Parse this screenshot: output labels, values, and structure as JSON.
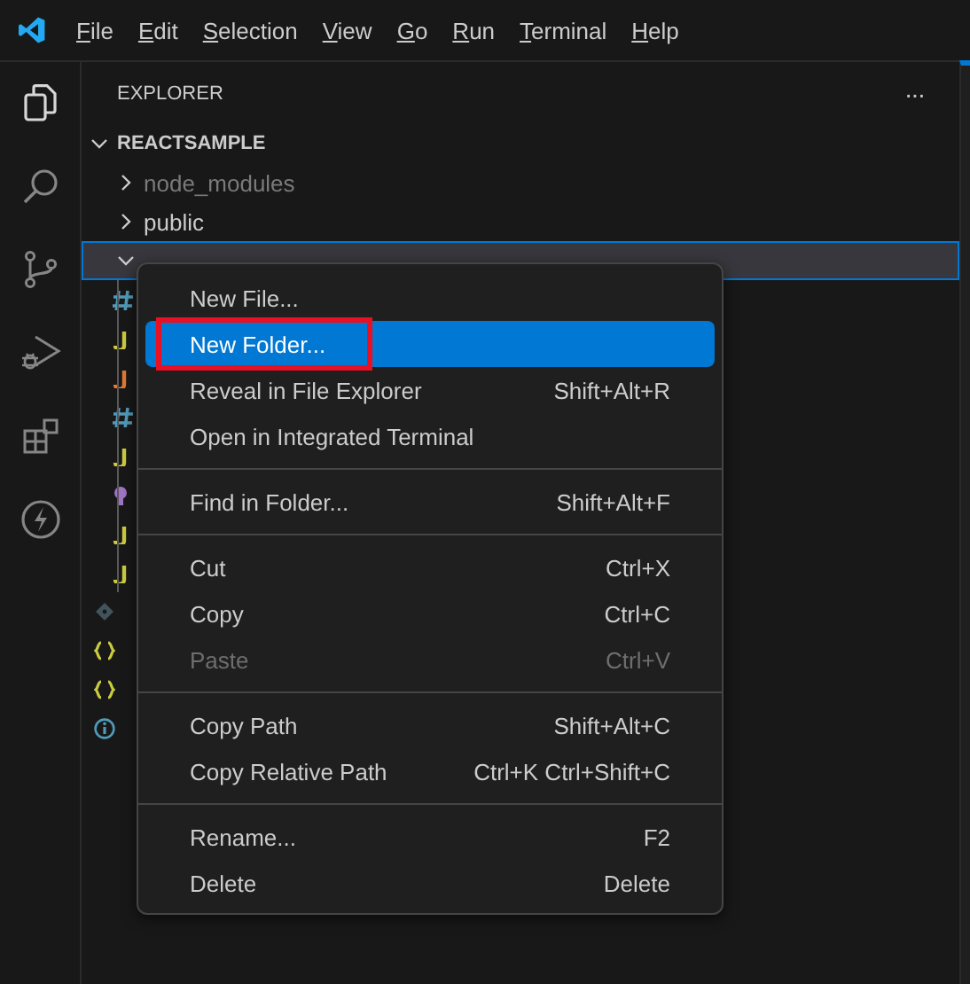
{
  "menu_bar": [
    "File",
    "Edit",
    "Selection",
    "View",
    "Go",
    "Run",
    "Terminal",
    "Help"
  ],
  "activity_bar": [
    {
      "kind": "explorer",
      "selected": true
    },
    {
      "kind": "search",
      "selected": false
    },
    {
      "kind": "source-control",
      "selected": false
    },
    {
      "kind": "run-debug",
      "selected": false
    },
    {
      "kind": "extensions",
      "selected": false
    },
    {
      "kind": "lightning",
      "selected": false
    }
  ],
  "explorer": {
    "title": "EXPLORER",
    "more": "···",
    "tree": [
      {
        "label": "REACTSAMPLE",
        "kind": "root",
        "expanded": true,
        "selected": false,
        "children": [
          {
            "label": "node_modules",
            "kind": "folder",
            "expanded": false,
            "selected": false,
            "dimmed": true
          },
          {
            "label": "public",
            "kind": "folder",
            "expanded": false,
            "selected": false,
            "dimmed": false
          },
          {
            "kind": "folder",
            "expanded": true,
            "selected": true,
            "children": [
              {
                "kind": "css"
              },
              {
                "kind": "js"
              },
              {
                "kind": "jsx"
              },
              {
                "kind": "css"
              },
              {
                "kind": "js"
              },
              {
                "kind": "svg"
              },
              {
                "kind": "js"
              },
              {
                "kind": "js"
              }
            ]
          },
          {
            "kind": "gitignore"
          },
          {
            "kind": "json"
          },
          {
            "kind": "json"
          },
          {
            "kind": "readme"
          }
        ]
      }
    ]
  },
  "context_menu": {
    "groups": [
      [
        {
          "label": "New File...",
          "selected": false,
          "disabled": false,
          "outlined": false
        },
        {
          "label": "New Folder...",
          "selected": true,
          "disabled": false,
          "outlined": true
        },
        {
          "label": "Reveal in File Explorer",
          "shortcut": "Shift+Alt+R",
          "selected": false,
          "disabled": false,
          "outlined": false
        },
        {
          "label": "Open in Integrated Terminal",
          "selected": false,
          "disabled": false,
          "outlined": false
        }
      ],
      [
        {
          "label": "Find in Folder...",
          "shortcut": "Shift+Alt+F",
          "selected": false,
          "disabled": false,
          "outlined": false
        }
      ],
      [
        {
          "label": "Cut",
          "shortcut": "Ctrl+X",
          "selected": false,
          "disabled": false,
          "outlined": false
        },
        {
          "label": "Copy",
          "shortcut": "Ctrl+C",
          "selected": false,
          "disabled": false,
          "outlined": false
        },
        {
          "label": "Paste",
          "shortcut": "Ctrl+V",
          "selected": false,
          "disabled": true,
          "outlined": false
        }
      ],
      [
        {
          "label": "Copy Path",
          "shortcut": "Shift+Alt+C",
          "selected": false,
          "disabled": false,
          "outlined": false
        },
        {
          "label": "Copy Relative Path",
          "shortcut": "Ctrl+K Ctrl+Shift+C",
          "selected": false,
          "disabled": false,
          "outlined": false
        }
      ],
      [
        {
          "label": "Rename...",
          "shortcut": "F2",
          "selected": false,
          "disabled": false,
          "outlined": false
        },
        {
          "label": "Delete",
          "shortcut": "Delete",
          "selected": false,
          "disabled": false,
          "outlined": false
        }
      ]
    ]
  }
}
